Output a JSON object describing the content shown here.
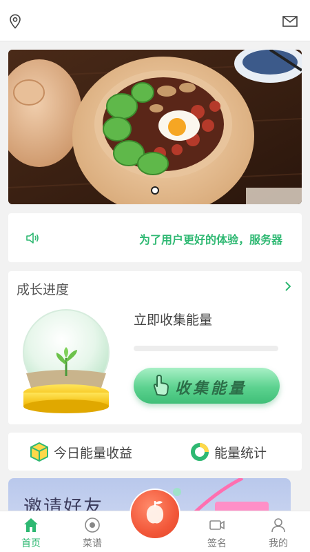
{
  "header": {
    "location_icon": "location-pin-icon",
    "mail_icon": "mail-icon"
  },
  "banner": {
    "image": "clay pot rice with bok choy, sausage and egg",
    "slide_count": 1,
    "active_slide": 1
  },
  "notice": {
    "icon": "speaker-icon",
    "text": "为了用户更好的体验，服务器"
  },
  "growth": {
    "title": "成长进度",
    "collect_label": "立即收集能量",
    "progress": 0,
    "collect_button": "收集能量"
  },
  "stats": {
    "today_energy": "今日能量收益",
    "energy_stats": "能量统计"
  },
  "invite": {
    "label": "邀请好友"
  },
  "tabbar": {
    "items": [
      {
        "label": "首页",
        "icon": "home-icon"
      },
      {
        "label": "菜谱",
        "icon": "recipe-icon"
      },
      {
        "label": "签名",
        "icon": "video-icon"
      },
      {
        "label": "我的",
        "icon": "user-icon"
      }
    ],
    "center_icon": "fruit-icon"
  },
  "colors": {
    "accent": "#2eb872",
    "tab_inactive": "#777777",
    "center_button": "#f2583a"
  }
}
